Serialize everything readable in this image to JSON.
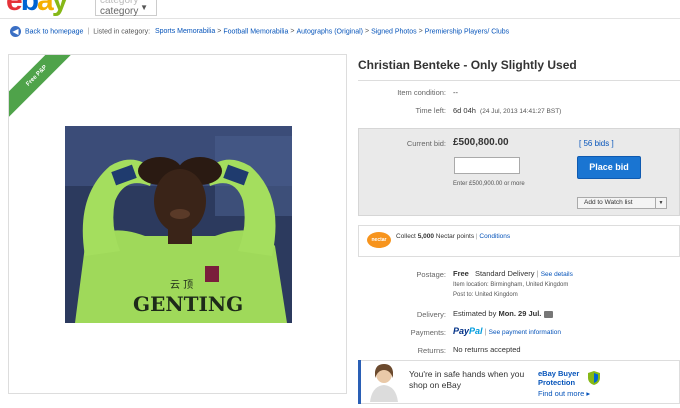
{
  "header": {
    "logo": {
      "e": "e",
      "b": "b",
      "a": "a",
      "y": "y"
    },
    "shop_by": {
      "line1": "category",
      "line2": "category"
    }
  },
  "breadcrumb": {
    "back": "Back to homepage",
    "listed": "Listed in category:",
    "items": [
      "Sports Memorabilia",
      "Football Memorabilia",
      "Autographs (Original)",
      "Signed Photos",
      "Premiership Players/ Clubs"
    ]
  },
  "image_panel": {
    "ribbon": "Free P&P"
  },
  "item": {
    "title": "Christian Benteke - Only Slightly Used",
    "condition_label": "Item condition:",
    "condition_value": "--",
    "time_left_label": "Time left:",
    "time_left_value": "6d 04h",
    "time_left_end": "(24 Jul, 2013   14:41:27 BST)"
  },
  "bid": {
    "current_label": "Current bid:",
    "current_value": "£500,800.00",
    "bids_link": "[ 56 bids ]",
    "input_value": "",
    "hint": "Enter £500,900.00 or more",
    "place_bid": "Place bid",
    "watch_list": "Add to Watch list"
  },
  "nectar": {
    "logo": "nectar",
    "text_pre": "Collect ",
    "points": "5,000",
    "text_post": " Nectar points",
    "conditions": "Conditions"
  },
  "postage": {
    "label": "Postage:",
    "value": "Free",
    "method": "Standard Delivery",
    "see_details": "See details",
    "location": "Item location: Birmingham, United Kingdom",
    "post_to": "Post to: United Kingdom"
  },
  "delivery": {
    "label": "Delivery:",
    "value": "Estimated by",
    "date": "Mon. 29 Jul."
  },
  "payments": {
    "label": "Payments:",
    "pay": "Pay",
    "pal": "Pal",
    "see_info": "See payment information"
  },
  "returns": {
    "label": "Returns:",
    "value": "No returns accepted"
  },
  "safe": {
    "text": "You're in safe hands when you shop on eBay",
    "buyer_protection": "eBay Buyer Protection",
    "find_more": "Find out more ▸"
  },
  "colors": {
    "accent": "#0654ba",
    "place_bid": "#1a75d2",
    "ribbon": "#4fa34a",
    "nectar": "#f7941d"
  }
}
